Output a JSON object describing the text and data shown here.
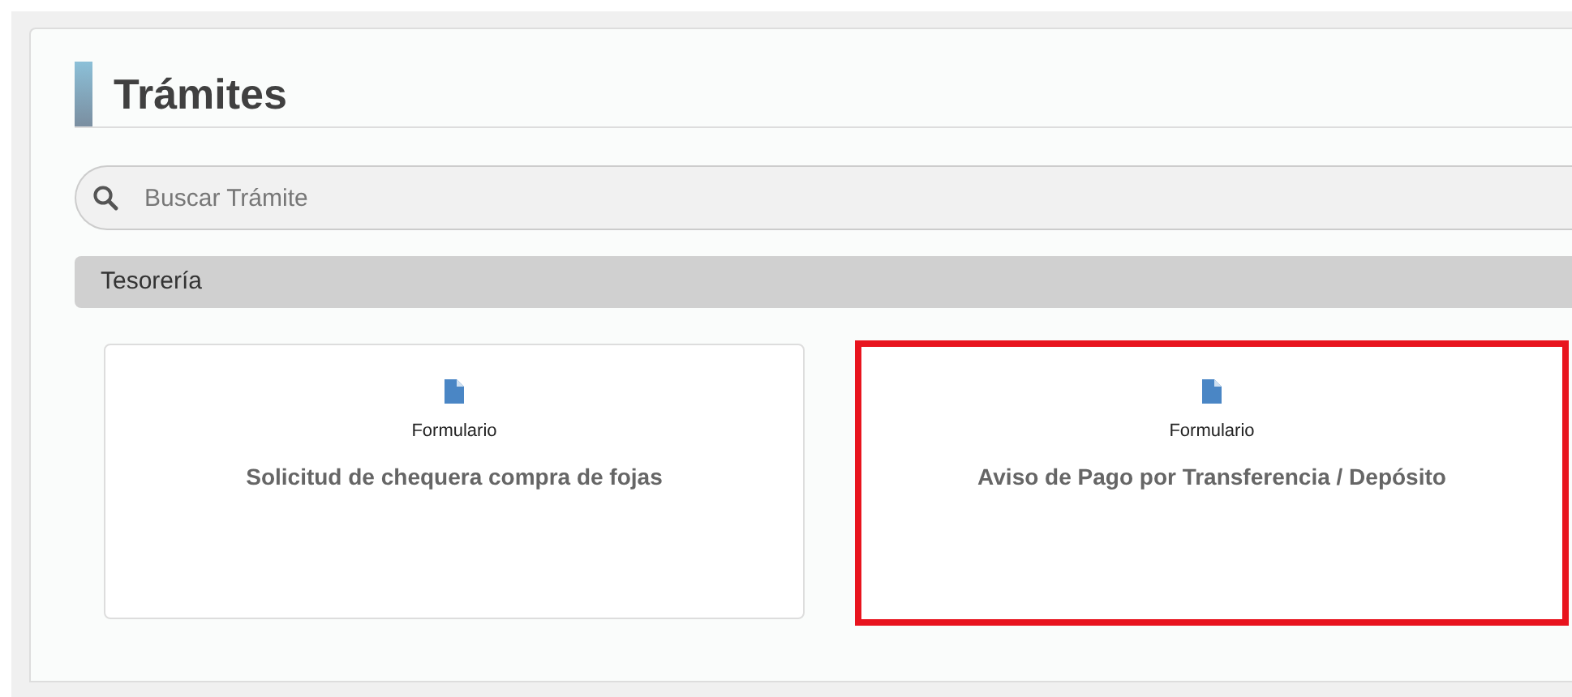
{
  "page_title": "Trámites",
  "search": {
    "placeholder": "Buscar Trámite"
  },
  "category": "Tesorería",
  "cards": [
    {
      "type": "Formulario",
      "title": "Solicitud de chequera compra de fojas",
      "highlighted": false
    },
    {
      "type": "Formulario",
      "title": "Aviso de Pago por Transferencia / Depósito",
      "highlighted": true
    }
  ]
}
